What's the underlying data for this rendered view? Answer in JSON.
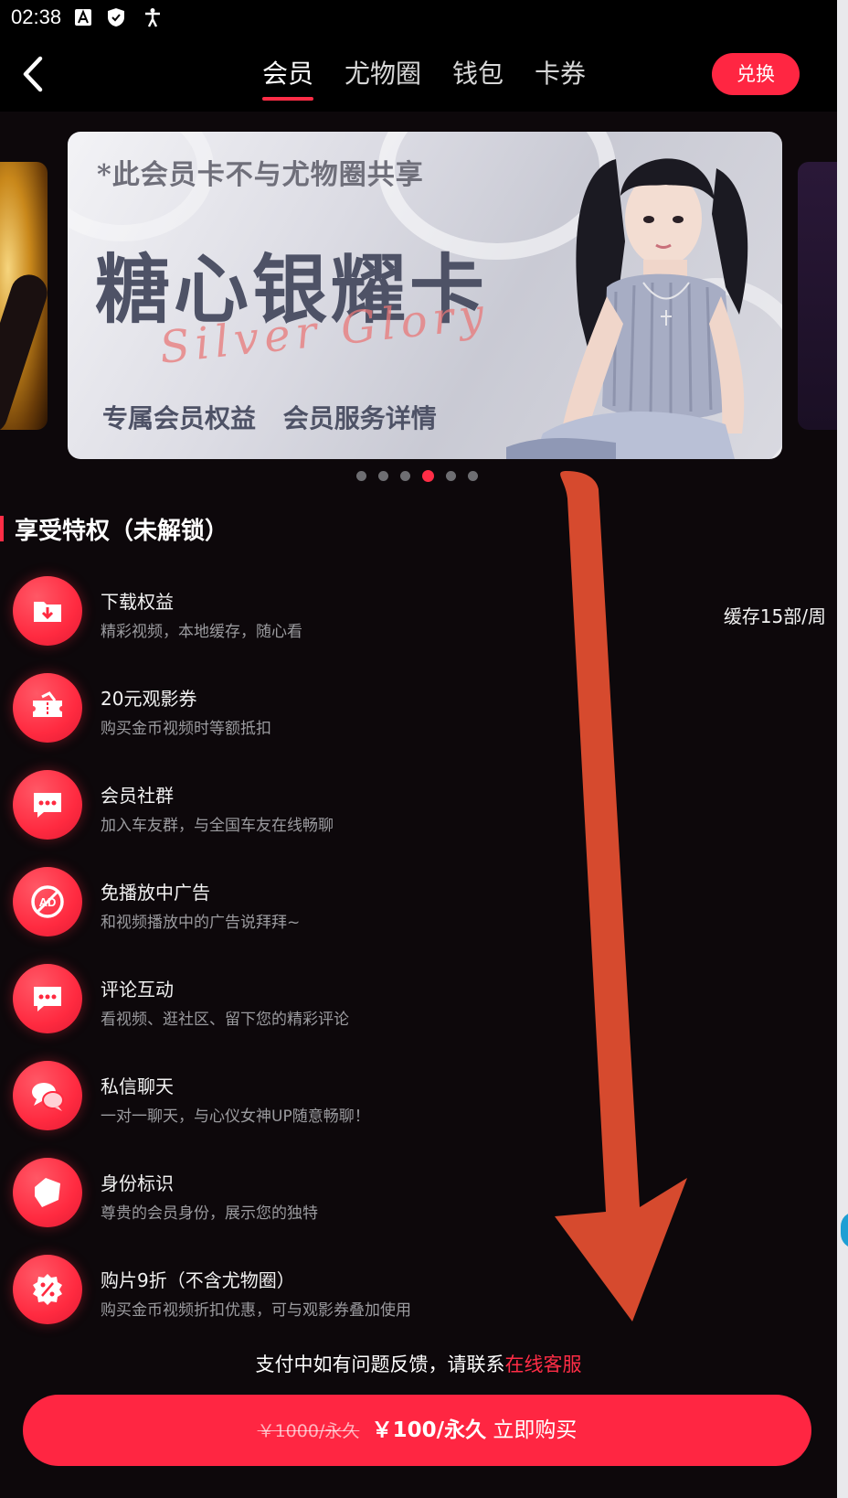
{
  "status_bar": {
    "time": "02:38",
    "icons": [
      "font-a-icon",
      "shield-icon",
      "accessibility-icon"
    ]
  },
  "header": {
    "back_icon": "chevron-left-icon",
    "tabs": [
      {
        "label": "会员",
        "active": true
      },
      {
        "label": "尤物圈",
        "active": false
      },
      {
        "label": "钱包",
        "active": false
      },
      {
        "label": "卡券",
        "active": false
      }
    ],
    "redeem_label": "兑换"
  },
  "banner": {
    "notice": "*此会员卡不与尤物圈共享",
    "title": "糖心银耀卡",
    "script": "Silver Glory",
    "link1": "专属会员权益",
    "link2": "会员服务详情",
    "page_count": 6,
    "active_index": 3
  },
  "privileges": {
    "title": "享受特权（未解锁）",
    "items": [
      {
        "name": "下载权益",
        "desc": "精彩视频，本地缓存，随心看",
        "extra": "缓存15部/周",
        "icon": "download-folder-icon"
      },
      {
        "name": "20元观影券",
        "desc": "购买金币视频时等额抵扣",
        "extra": "",
        "icon": "ticket-icon"
      },
      {
        "name": "会员社群",
        "desc": "加入车友群，与全国车友在线畅聊",
        "extra": "",
        "icon": "chat-bubble-icon"
      },
      {
        "name": "免播放中广告",
        "desc": "和视频播放中的广告说拜拜~",
        "extra": "",
        "icon": "no-ads-icon"
      },
      {
        "name": "评论互动",
        "desc": "看视频、逛社区、留下您的精彩评论",
        "extra": "",
        "icon": "comment-icon"
      },
      {
        "name": "私信聊天",
        "desc": "一对一聊天，与心仪女神UP随意畅聊！",
        "extra": "",
        "icon": "messages-icon"
      },
      {
        "name": "身份标识",
        "desc": "尊贵的会员身份，展示您的独特",
        "extra": "",
        "icon": "badge-icon"
      },
      {
        "name": "购片9折（不含尤物圈）",
        "desc": "购买金币视频折扣优惠，可与观影券叠加使用",
        "extra": "",
        "icon": "discount-icon"
      }
    ]
  },
  "footer": {
    "support_text": "支付中如有问题反馈，请联系",
    "support_link": "在线客服",
    "old_price": "￥1000/永久",
    "price": "￥100/永久",
    "buy_label": "立即购买"
  },
  "colors": {
    "accent": "#ff2642",
    "background": "#0d080b",
    "overlay_arrow": "#d64a2e"
  }
}
